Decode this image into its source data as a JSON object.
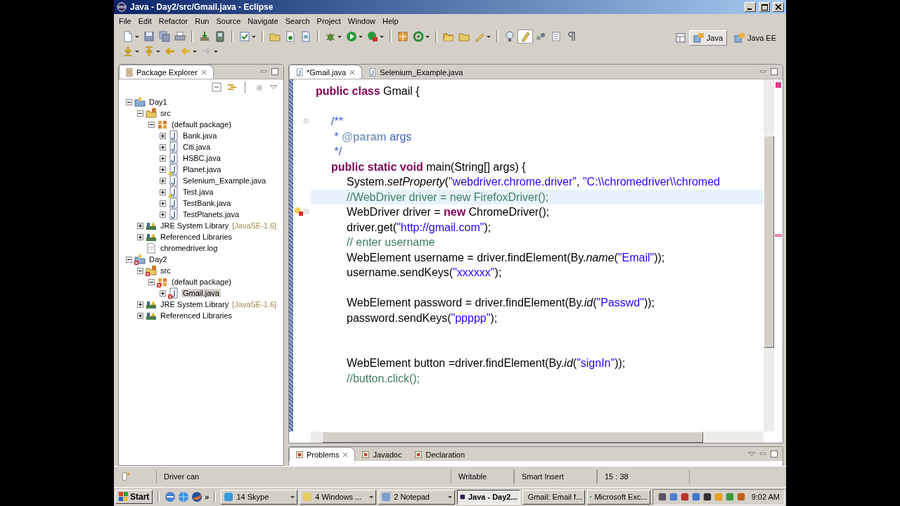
{
  "window": {
    "title": "Java - Day2/src/Gmail.java - Eclipse"
  },
  "menu": [
    "File",
    "Edit",
    "Refactor",
    "Run",
    "Source",
    "Navigate",
    "Search",
    "Project",
    "Window",
    "Help"
  ],
  "perspectives": [
    {
      "label": "Java",
      "selected": true
    },
    {
      "label": "Java EE",
      "selected": false
    }
  ],
  "package_explorer": {
    "title": "Package Explorer",
    "tree": [
      {
        "label": "Day1",
        "kind": "project",
        "error": false,
        "warning": false,
        "expanded": true,
        "selected": false,
        "children": [
          {
            "label": "src",
            "kind": "source-folder",
            "error": false,
            "warning": false,
            "expanded": true,
            "selected": false,
            "children": [
              {
                "label": "(default package)",
                "kind": "package",
                "error": false,
                "warning": false,
                "expanded": true,
                "selected": false,
                "children": [
                  {
                    "label": "Bank.java",
                    "kind": "java",
                    "error": false,
                    "warning": false,
                    "expanded": false,
                    "selected": false
                  },
                  {
                    "label": "Citi.java",
                    "kind": "java",
                    "error": false,
                    "warning": false,
                    "expanded": false,
                    "selected": false
                  },
                  {
                    "label": "HSBC.java",
                    "kind": "java",
                    "error": false,
                    "warning": false,
                    "expanded": false,
                    "selected": false
                  },
                  {
                    "label": "Planet.java",
                    "kind": "java",
                    "error": false,
                    "warning": true,
                    "expanded": false,
                    "selected": false
                  },
                  {
                    "label": "Selenium_Example.java",
                    "kind": "java",
                    "error": false,
                    "warning": false,
                    "expanded": false,
                    "selected": false
                  },
                  {
                    "label": "Test.java",
                    "kind": "java",
                    "error": false,
                    "warning": true,
                    "expanded": false,
                    "selected": false
                  },
                  {
                    "label": "TestBank.java",
                    "kind": "java",
                    "error": false,
                    "warning": false,
                    "expanded": false,
                    "selected": false
                  },
                  {
                    "label": "TestPlanets.java",
                    "kind": "java",
                    "error": false,
                    "warning": false,
                    "expanded": false,
                    "selected": false
                  }
                ]
              }
            ]
          },
          {
            "label": "JRE System Library",
            "detail": "[JavaSE-1.6]",
            "kind": "library",
            "error": false,
            "warning": false,
            "expanded": false,
            "selected": false
          },
          {
            "label": "Referenced Libraries",
            "kind": "library",
            "error": false,
            "warning": false,
            "expanded": false,
            "selected": false
          },
          {
            "label": "chromedriver.log",
            "kind": "file",
            "error": false,
            "warning": false,
            "expanded": false,
            "selected": false
          }
        ]
      },
      {
        "label": "Day2",
        "kind": "project",
        "error": true,
        "warning": false,
        "expanded": true,
        "selected": false,
        "children": [
          {
            "label": "src",
            "kind": "source-folder",
            "error": true,
            "warning": false,
            "expanded": true,
            "selected": false,
            "children": [
              {
                "label": "(default package)",
                "kind": "package",
                "error": true,
                "warning": false,
                "expanded": true,
                "selected": false,
                "children": [
                  {
                    "label": "Gmail.java",
                    "kind": "java",
                    "error": true,
                    "warning": false,
                    "expanded": false,
                    "selected": true
                  }
                ]
              }
            ]
          },
          {
            "label": "JRE System Library",
            "detail": "[JavaSE-1.6]",
            "kind": "library",
            "error": false,
            "warning": false,
            "expanded": false,
            "selected": false
          },
          {
            "label": "Referenced Libraries",
            "kind": "library",
            "error": false,
            "warning": false,
            "expanded": false,
            "selected": false
          }
        ]
      }
    ]
  },
  "editor": {
    "tabs": [
      {
        "label": "*Gmail.java",
        "selected": true
      },
      {
        "label": "Selenium_Example.java",
        "selected": false
      }
    ],
    "lines": [
      {
        "kind": "top",
        "highlighted": false,
        "segments": [
          {
            "kind": "keyword",
            "text": "public class"
          },
          {
            "kind": "plain",
            "text": " Gmail {"
          }
        ]
      },
      {
        "kind": "blank",
        "highlighted": false
      },
      {
        "kind": "member",
        "highlighted": false,
        "segments": [
          {
            "kind": "javadoc",
            "text": "/**"
          }
        ]
      },
      {
        "kind": "member",
        "highlighted": false,
        "segments": [
          {
            "kind": "javadoc",
            "text": " * "
          },
          {
            "kind": "tag",
            "text": "@param"
          },
          {
            "kind": "javadoc",
            "text": " args"
          }
        ]
      },
      {
        "kind": "member",
        "highlighted": false,
        "segments": [
          {
            "kind": "javadoc",
            "text": " */"
          }
        ]
      },
      {
        "kind": "member",
        "highlighted": false,
        "segments": [
          {
            "kind": "keyword",
            "text": "public static void"
          },
          {
            "kind": "plain",
            "text": " main(String[] args) {"
          }
        ]
      },
      {
        "kind": "body",
        "highlighted": false,
        "segments": [
          {
            "kind": "plain",
            "text": "System."
          },
          {
            "kind": "italic",
            "text": "setProperty"
          },
          {
            "kind": "plain",
            "text": "("
          },
          {
            "kind": "string",
            "text": "\"webdriver.chrome.driver\""
          },
          {
            "kind": "plain",
            "text": ", "
          },
          {
            "kind": "string",
            "text": "\"C:\\\\chromedriver\\\\chromed"
          }
        ]
      },
      {
        "kind": "body",
        "highlighted": true,
        "segments": [
          {
            "kind": "comment",
            "text": "//WebDriver driver = new FirefoxDriver();"
          }
        ]
      },
      {
        "kind": "body",
        "highlighted": false,
        "segments": [
          {
            "kind": "plain",
            "text": "WebDriver driver = "
          },
          {
            "kind": "keyword",
            "text": "new"
          },
          {
            "kind": "plain",
            "text": " ChromeDriver();"
          }
        ]
      },
      {
        "kind": "body",
        "highlighted": false,
        "segments": [
          {
            "kind": "plain",
            "text": "driver.get("
          },
          {
            "kind": "string",
            "text": "\"http://gmail.com\""
          },
          {
            "kind": "plain",
            "text": ");"
          }
        ]
      },
      {
        "kind": "body",
        "highlighted": false,
        "segments": [
          {
            "kind": "comment",
            "text": "// enter username"
          }
        ]
      },
      {
        "kind": "body",
        "highlighted": false,
        "segments": [
          {
            "kind": "plain",
            "text": "WebElement username = driver.findElement(By."
          },
          {
            "kind": "italic",
            "text": "name"
          },
          {
            "kind": "plain",
            "text": "("
          },
          {
            "kind": "string",
            "text": "\"Email\""
          },
          {
            "kind": "plain",
            "text": "));"
          }
        ]
      },
      {
        "kind": "body",
        "highlighted": false,
        "segments": [
          {
            "kind": "plain",
            "text": "username.sendKeys("
          },
          {
            "kind": "string",
            "text": "\"xxxxxx\""
          },
          {
            "kind": "plain",
            "text": ");"
          }
        ]
      },
      {
        "kind": "blank",
        "highlighted": false
      },
      {
        "kind": "body",
        "highlighted": false,
        "segments": [
          {
            "kind": "plain",
            "text": "WebElement password = driver.findElement(By."
          },
          {
            "kind": "italic",
            "text": "id"
          },
          {
            "kind": "plain",
            "text": "("
          },
          {
            "kind": "string",
            "text": "\"Passwd\""
          },
          {
            "kind": "plain",
            "text": "));"
          }
        ]
      },
      {
        "kind": "body",
        "highlighted": false,
        "segments": [
          {
            "kind": "plain",
            "text": "password.sendKeys("
          },
          {
            "kind": "string",
            "text": "\"ppppp\""
          },
          {
            "kind": "plain",
            "text": ");"
          }
        ]
      },
      {
        "kind": "blank",
        "highlighted": false
      },
      {
        "kind": "blank",
        "highlighted": false
      },
      {
        "kind": "body",
        "highlighted": false,
        "segments": [
          {
            "kind": "plain",
            "text": "WebElement button =driver.findElement(By."
          },
          {
            "kind": "italic",
            "text": "id"
          },
          {
            "kind": "plain",
            "text": "("
          },
          {
            "kind": "string",
            "text": "\"signIn\""
          },
          {
            "kind": "plain",
            "text": "));"
          }
        ]
      },
      {
        "kind": "body",
        "highlighted": false,
        "segments": [
          {
            "kind": "comment",
            "text": "//button.click();"
          }
        ]
      }
    ]
  },
  "bottom_panel": {
    "tabs": [
      {
        "label": "Problems",
        "selected": true
      },
      {
        "label": "Javadoc",
        "selected": false
      },
      {
        "label": "Declaration",
        "selected": false
      }
    ]
  },
  "status_bar": {
    "message": "Driver can",
    "fields": [
      "Writable",
      "Smart Insert",
      "15 : 38"
    ]
  },
  "taskbar": {
    "start": "Start",
    "overflow": "»",
    "tasks": [
      {
        "label": "14 Skype",
        "kind": "group",
        "selected": false
      },
      {
        "label": "4 Windows ...",
        "kind": "group",
        "selected": false
      },
      {
        "label": "2 Notepad",
        "kind": "group",
        "selected": false
      },
      {
        "label": "Java - Day2...",
        "kind": "single",
        "selected": true
      },
      {
        "label": "Gmail: Email f...",
        "kind": "single",
        "selected": false
      },
      {
        "label": "Microsoft Exc...",
        "kind": "single",
        "selected": false
      }
    ],
    "clock": "9:02 AM"
  }
}
